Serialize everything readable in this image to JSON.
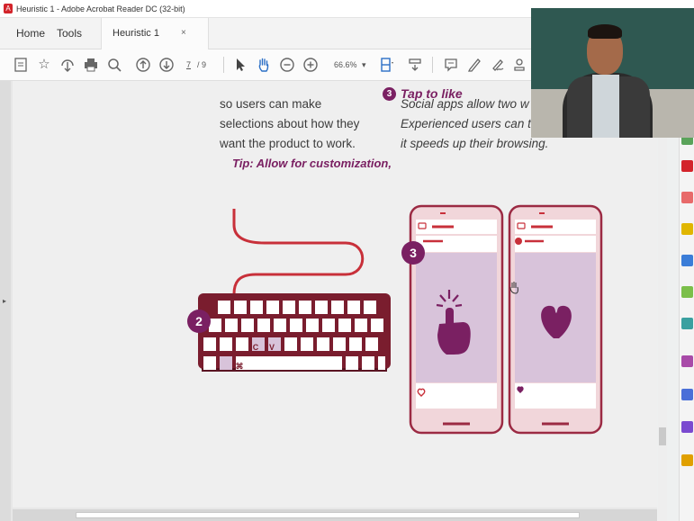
{
  "window": {
    "title": "Heuristic 1 - Adobe Acrobat Reader DC (32-bit)"
  },
  "menu": {
    "home": "Home",
    "tools": "Tools"
  },
  "tab": {
    "label": "Heuristic 1",
    "close": "×"
  },
  "toolbar": {
    "page_current": "7",
    "page_total": "/ 9",
    "zoom": "66.6%",
    "zoom_arrow": "▾"
  },
  "document": {
    "tip_header": "Tip: Allow for customization,",
    "tip_lines": [
      "so users can make",
      "selections about how they",
      "want the product to work."
    ],
    "section_number": "3",
    "section_title": "Tap to like",
    "section_lines": [
      "Social apps allow two w",
      "Experienced users can tap to like because",
      "it speeds up their browsing."
    ],
    "keyboard_badge": "2",
    "phone_badge": "3",
    "key_c": "C",
    "key_v": "V",
    "key_cmd": "⌘"
  },
  "colors": {
    "brand_red": "#d3242b",
    "accent_purple": "#7a2062",
    "keyboard_maroon": "#7a1d2e",
    "phone_pink": "#f1d6da",
    "phone_border": "#c2475c",
    "content_lilac": "#d8c3da"
  }
}
